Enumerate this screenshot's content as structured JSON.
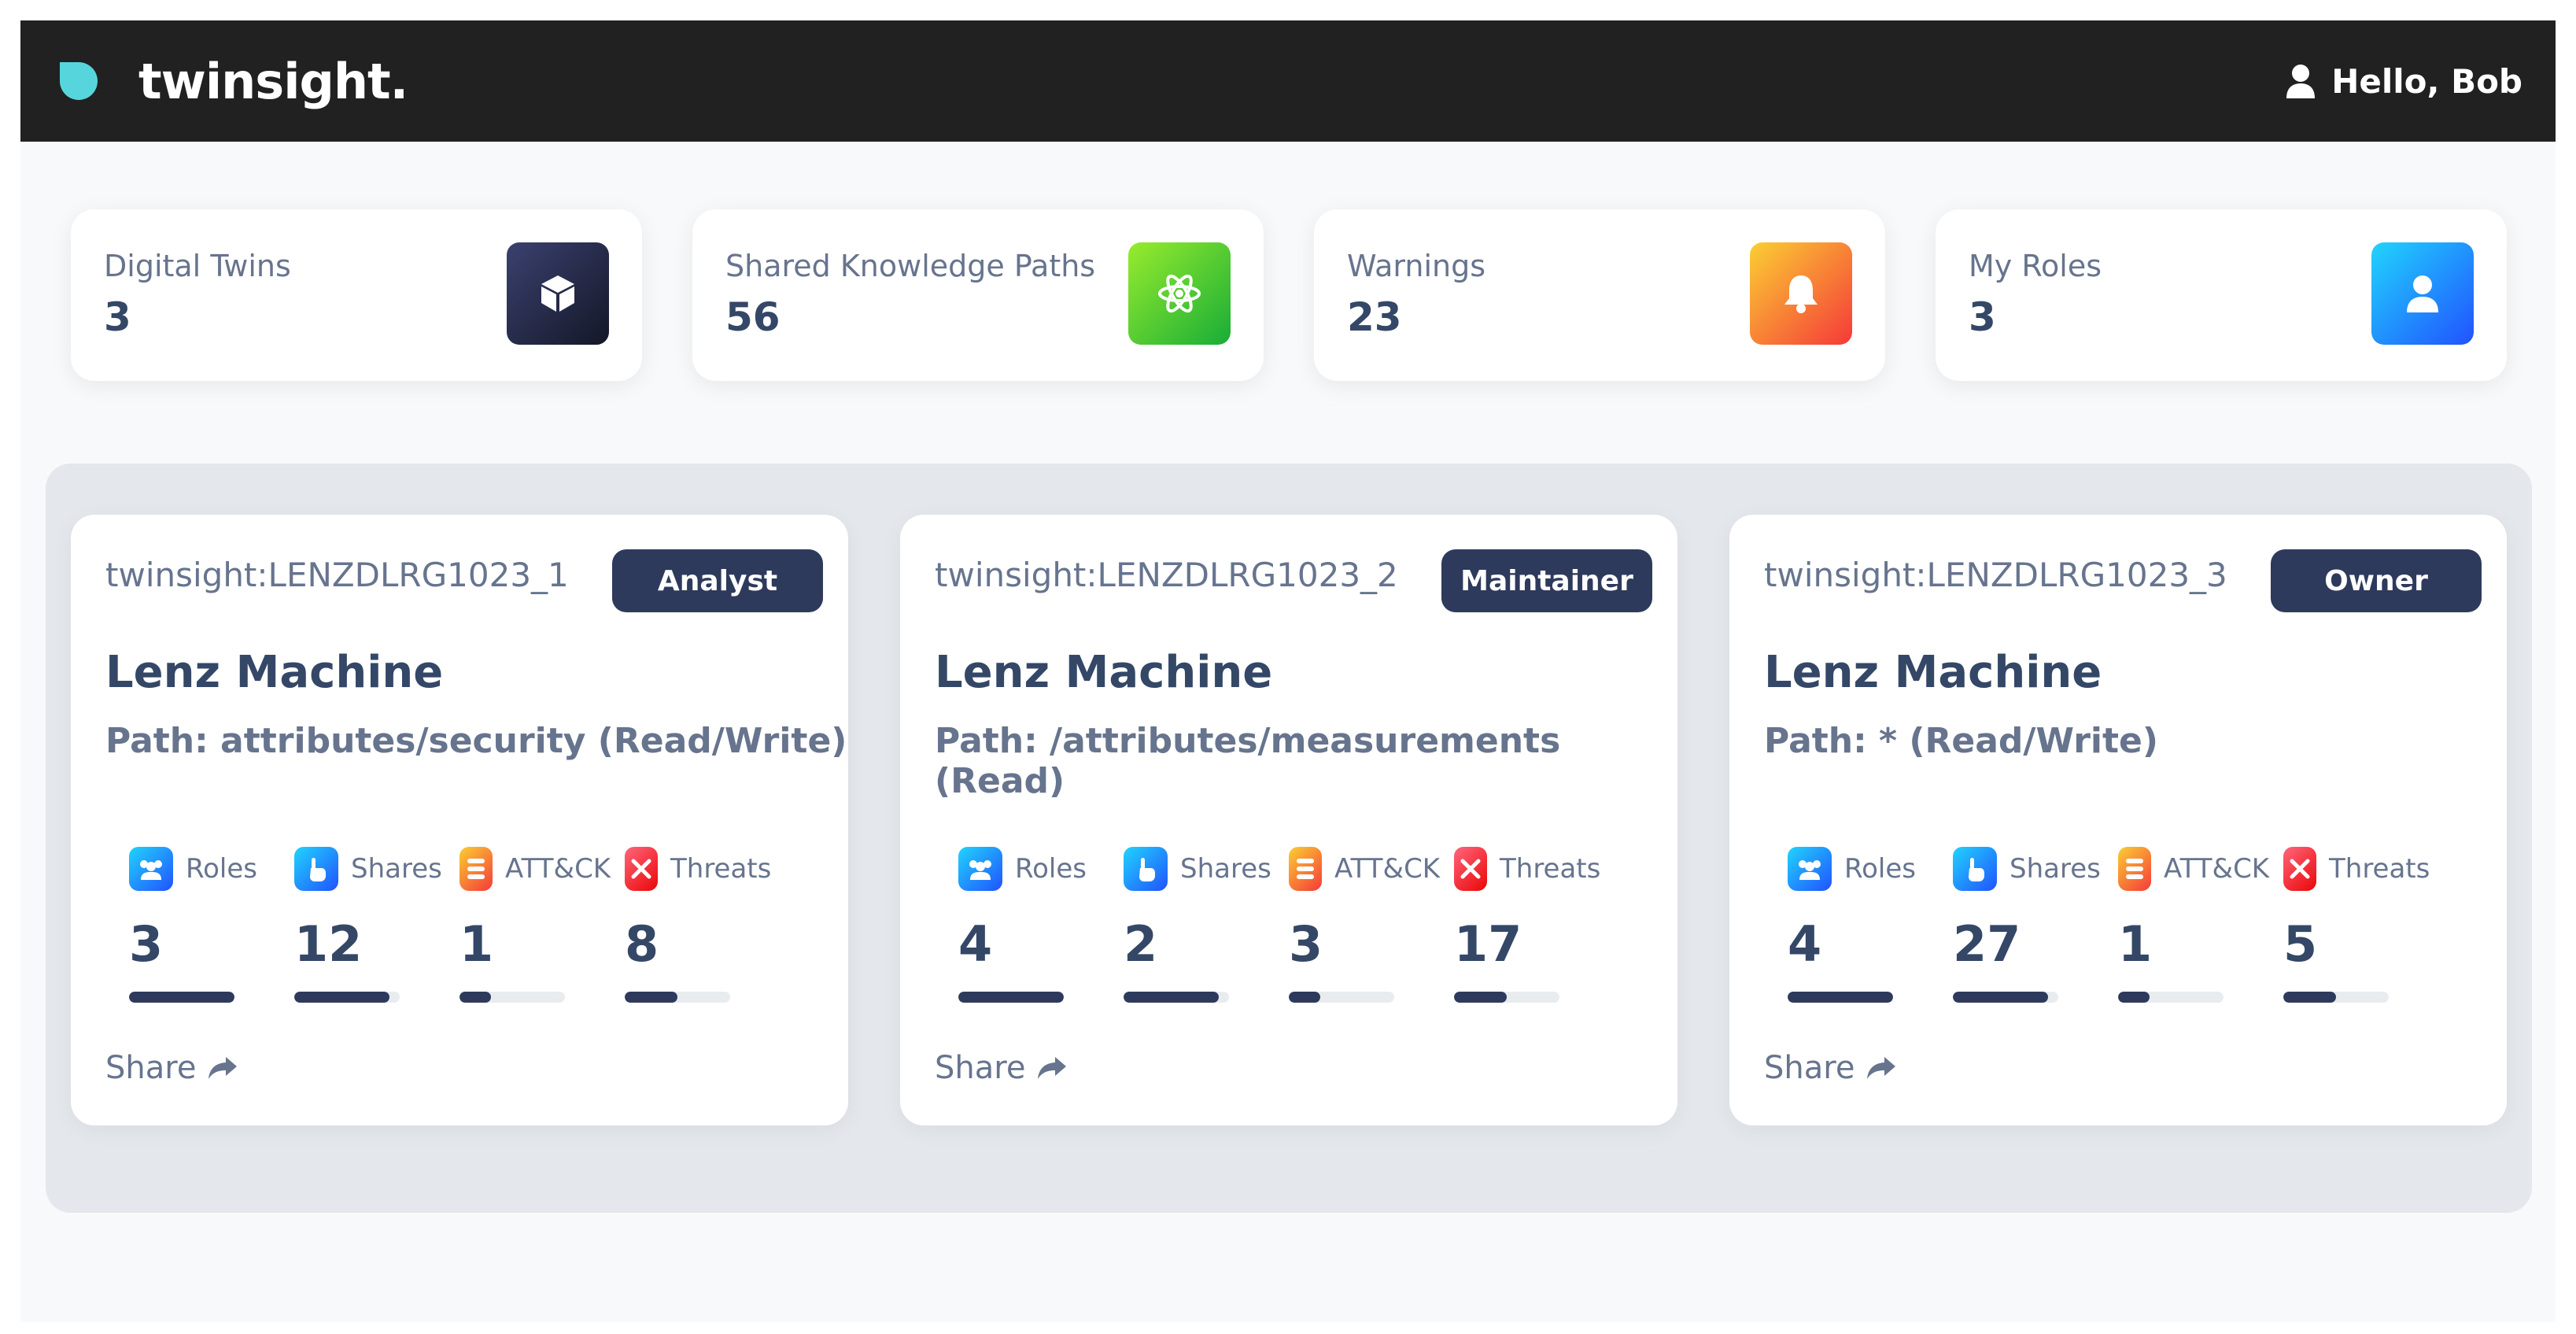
{
  "header": {
    "brand": "twinsight.",
    "greeting": "Hello, Bob"
  },
  "stats": [
    {
      "label": "Digital Twins",
      "value": "3",
      "icon": "cube-icon",
      "color": "#1a2040"
    },
    {
      "label": "Shared Knowledge Paths",
      "value": "56",
      "icon": "atom-icon",
      "color": "#43c62e"
    },
    {
      "label": "Warnings",
      "value": "23",
      "icon": "bell-icon",
      "color": "#fb8c2c"
    },
    {
      "label": "My Roles",
      "value": "3",
      "icon": "user-icon",
      "color": "#1e90ff"
    }
  ],
  "metric_labels": {
    "roles": "Roles",
    "shares": "Shares",
    "attck": "ATT&CK",
    "threats": "Threats"
  },
  "twins": [
    {
      "id": "twinsight:LENZDLRG1023_1",
      "role": "Analyst",
      "title": "Lenz Machine",
      "path": "Path: attributes/security (Read/Write)",
      "metrics": {
        "roles": 3,
        "shares": 12,
        "attck": 1,
        "threats": 8
      },
      "progress": {
        "roles": 1.0,
        "shares": 0.9,
        "attck": 0.3,
        "threats": 0.5
      },
      "share_label": "Share"
    },
    {
      "id": "twinsight:LENZDLRG1023_2",
      "role": "Maintainer",
      "title": "Lenz Machine",
      "path": "Path: /attributes/measurements (Read)",
      "metrics": {
        "roles": 4,
        "shares": 2,
        "attck": 3,
        "threats": 17
      },
      "progress": {
        "roles": 1.0,
        "shares": 0.9,
        "attck": 0.3,
        "threats": 0.5
      },
      "share_label": "Share"
    },
    {
      "id": "twinsight:LENZDLRG1023_3",
      "role": "Owner",
      "title": "Lenz Machine",
      "path": "Path: * (Read/Write)",
      "metrics": {
        "roles": 4,
        "shares": 27,
        "attck": 1,
        "threats": 5
      },
      "progress": {
        "roles": 1.0,
        "shares": 0.9,
        "attck": 0.3,
        "threats": 0.5
      },
      "share_label": "Share"
    }
  ],
  "colors": {
    "navbar": "#212121",
    "badge": "#2e3a5c",
    "roles_icon": "#1e90ff",
    "shares_icon": "#1e78ff",
    "attck_icon": "#fb8c2c",
    "threats_icon": "#f5365c"
  }
}
